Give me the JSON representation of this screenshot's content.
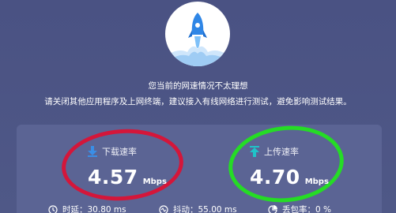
{
  "status": {
    "line1": "您当前的网速情况不太理想",
    "line2": "请关闭其他应用程序及上网终端，建议接入有线网络进行测试，避免影响测试结果。"
  },
  "download": {
    "label": "下载速率",
    "value": "4.57",
    "unit": "Mbps"
  },
  "upload": {
    "label": "上传速率",
    "value": "4.70",
    "unit": "Mbps"
  },
  "stats": {
    "latency": "时延：30.80 ms",
    "jitter": "抖动：55.00 ms",
    "loss": "丢包率：0 %"
  },
  "icons": {
    "logo": "rocket-icon",
    "download": "download-arrow-icon",
    "upload": "upload-arrow-icon",
    "latency": "clock-icon",
    "jitter": "jitter-icon",
    "loss": "pie-icon"
  },
  "colors": {
    "background": "#4d5685",
    "panel": "#5b6494",
    "download_arrow": "#3a8ee6",
    "upload_arrow": "#20c3c9",
    "annotation_red": "#d4163a",
    "annotation_green": "#25dc25"
  }
}
